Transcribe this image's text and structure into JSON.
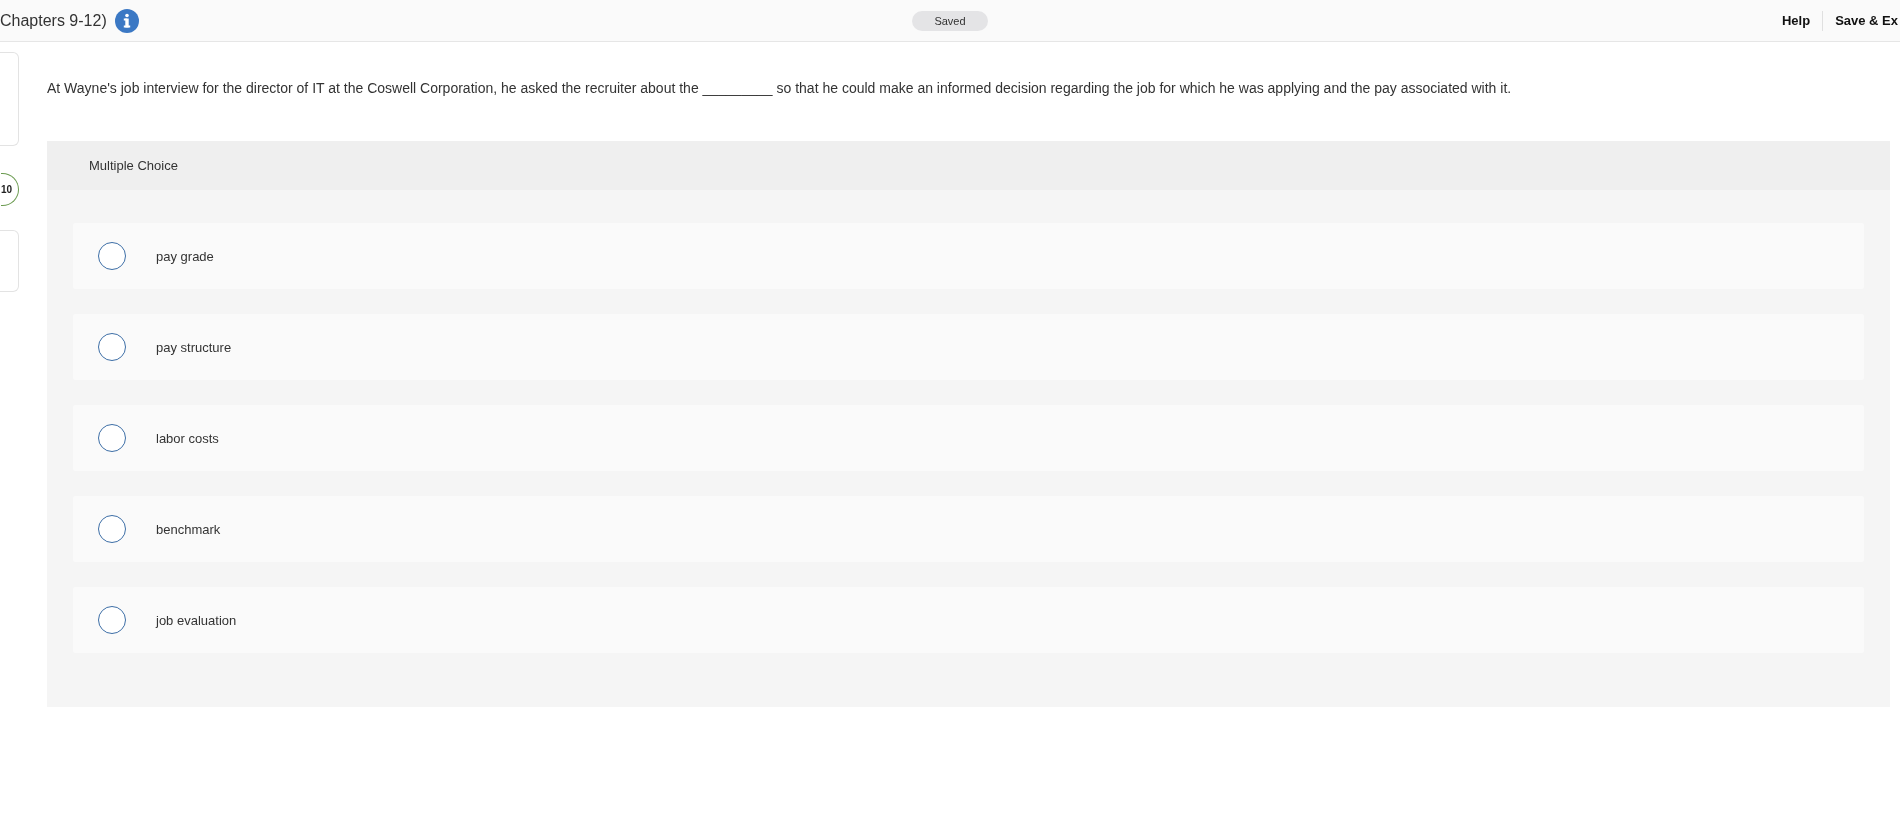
{
  "header": {
    "title": "Chapters 9-12)",
    "status": "Saved",
    "links": [
      "Help",
      "Save & Ex"
    ]
  },
  "sidebar": {
    "badge": "10"
  },
  "question": {
    "text": "At Wayne's job interview for the director of IT at the Coswell Corporation, he asked the recruiter about the _________ so that he could make an informed decision regarding the job for which he was applying and the pay associated with it.",
    "type_label": "Multiple Choice",
    "options": [
      {
        "label": "pay grade",
        "selected": false
      },
      {
        "label": "pay structure",
        "selected": false
      },
      {
        "label": "labor costs",
        "selected": false
      },
      {
        "label": "benchmark",
        "selected": false
      },
      {
        "label": "job evaluation",
        "selected": false
      }
    ]
  }
}
